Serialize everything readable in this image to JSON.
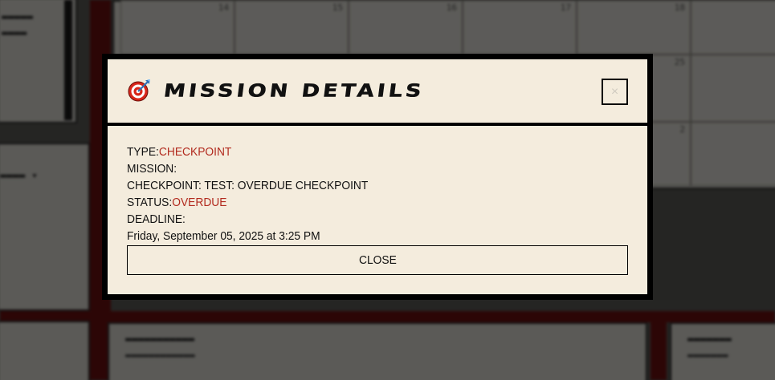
{
  "modal": {
    "title": "MISSION DETAILS",
    "close_icon": "×",
    "icon": "target-icon",
    "type_label": "TYPE:",
    "type_value": "CHECKPOINT",
    "mission_label": "MISSION:",
    "checkpoint_line": "CHECKPOINT: TEST: OVERDUE CHECKPOINT",
    "status_label": "STATUS:",
    "status_value": "OVERDUE",
    "deadline_label": "DEADLINE:",
    "deadline_value": "Friday, September 05, 2025 at 3:25 PM",
    "close_button": "CLOSE"
  },
  "colors": {
    "modal_bg": "#f4ecdd",
    "accent_red": "#b22a1e",
    "border": "#000000"
  }
}
